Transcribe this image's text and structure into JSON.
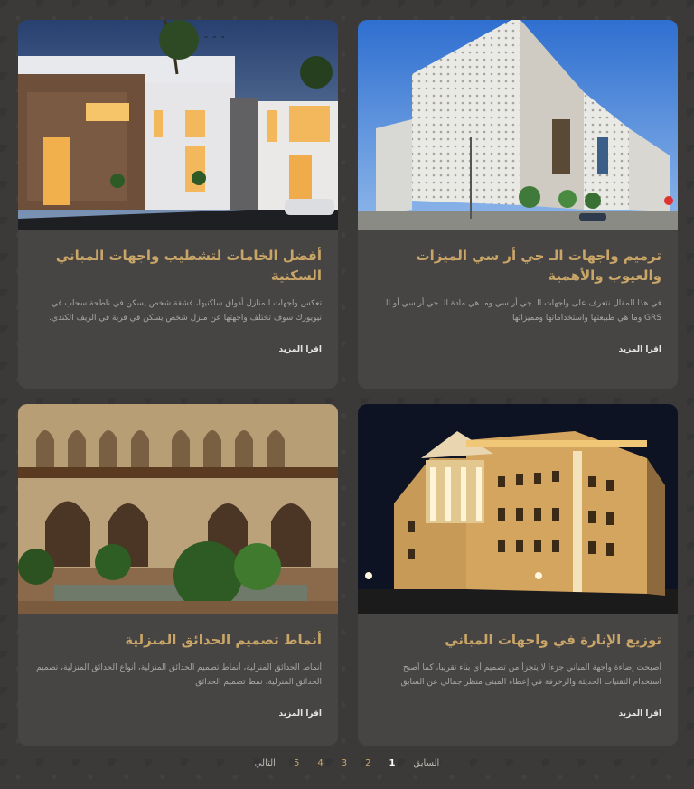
{
  "cards": [
    {
      "title": "ترميم واجهات الـ جي أر سي الميزات والعيوب والأهمية",
      "excerpt": "في هذا المقال نتعرف على واجهات الـ جي أر سي وما هي مادة الـ جي أر سي أو الـ GRS وما هي طبيعتها واستخداماتها ومميزاتها",
      "more": "اقرا المزيد",
      "image": "white-perforated-facade-building"
    },
    {
      "title": "أفضل الخامات لتشطيب واجهات المباني السكنية",
      "excerpt": "تعكس واجهات المنازل أذواق ساكنيها، فشقة شخص يسكن في ناطحة سحاب في نيويورك سوف تختلف واجهتها عن منزل شخص يسكن في قرية في الريف الكندي.",
      "more": "اقرا المزيد",
      "image": "modern-villa-at-dusk"
    },
    {
      "title": "توزيع الإنارة في واجهات المباني",
      "excerpt": "أصبحت إضاءة واجهة المباني جزءا لا يتجزأ من تصميم أي بناء تقريبا، كما أصبح استخدام التقنيات الحديثة والزخرفة في إعطاء المبنى منظر جمالي عن السابق",
      "more": "اقرا المزيد",
      "image": "illuminated-classic-building-night"
    },
    {
      "title": "أنماط تصميم الحدائق المنزلية",
      "excerpt": "أنماط الحدائق المنزلية، أنماط تصميم الحدائق المنزلية، أنواع الحدائق المنزلية، تصميم الحدائق المنزلية، نمط تصميم الحدائق",
      "more": "اقرا المزيد",
      "image": "andalusian-courtyard-garden"
    }
  ],
  "pagination": {
    "prev": "السابق",
    "pages": [
      "1",
      "2",
      "3",
      "4",
      "5"
    ],
    "current": "1",
    "next": "التالي"
  }
}
